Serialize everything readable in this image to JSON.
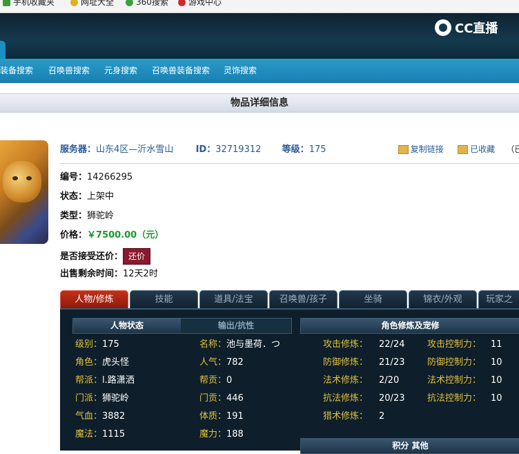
{
  "bookmarks": [
    {
      "label": "手机收藏夹",
      "color": "#3a9a3a"
    },
    {
      "label": "网址大全",
      "color": "#e0b020"
    },
    {
      "label": "360搜索",
      "color": "#3aa040"
    },
    {
      "label": "游戏中心",
      "color": "#d02a2a"
    }
  ],
  "header": {
    "logo": "CC直播"
  },
  "nav": [
    "装备搜索",
    "召唤兽搜索",
    "元身搜索",
    "召唤兽装备搜索",
    "灵饰搜索"
  ],
  "page_title": "物品详细信息",
  "info": {
    "server_label": "服务器：",
    "server_value": "山东4区—沂水雪山",
    "id_label": "ID：",
    "id_value": "32719312",
    "level_label": "等级：",
    "level_value": "175",
    "copy_link": "复制链接",
    "favorited": "已收藏",
    "trailing": "（已有"
  },
  "details": {
    "number_label": "编号：",
    "number_value": "14266295",
    "status_label": "状态：",
    "status_value": "上架中",
    "type_label": "类型：",
    "type_value": "狮驼岭",
    "price_label": "价格：",
    "price_value": "￥7500.00（元）",
    "haggle_label": "是否接受还价：",
    "haggle_button": "还价",
    "time_label": "出售剩余时间：",
    "time_value": "12天2时"
  },
  "tabs": [
    "人物/修炼",
    "技能",
    "道具/法宝",
    "召唤兽/孩子",
    "坐骑",
    "锦衣/外观",
    "玩家之"
  ],
  "subtabs": [
    "人物状态",
    "输出/抗性"
  ],
  "section_titles": {
    "cultivation": "角色修炼及宠修",
    "score": "积分 其他"
  },
  "stats_col1": [
    {
      "k": "级别：",
      "v": "175"
    },
    {
      "k": "角色：",
      "v": "虎头怪"
    },
    {
      "k": "帮派：",
      "v": "l.路潇洒"
    },
    {
      "k": "门派：",
      "v": "狮驼岭"
    },
    {
      "k": "气血：",
      "v": "3882"
    },
    {
      "k": "魔法：",
      "v": "1115"
    }
  ],
  "stats_col2": [
    {
      "k": "名称：",
      "v": "池与墨荷．つ"
    },
    {
      "k": "人气：",
      "v": "782"
    },
    {
      "k": "帮贡：",
      "v": "0"
    },
    {
      "k": "门贡：",
      "v": "446"
    },
    {
      "k": "体质：",
      "v": "191"
    },
    {
      "k": "魔力：",
      "v": "188"
    }
  ],
  "cultivation_col1": [
    {
      "k": "攻击修炼：",
      "v": "22/24"
    },
    {
      "k": "防御修炼：",
      "v": "21/23"
    },
    {
      "k": "法术修炼：",
      "v": "2/20"
    },
    {
      "k": "抗法修炼：",
      "v": "20/23"
    },
    {
      "k": "猎术修炼：",
      "v": "2"
    }
  ],
  "cultivation_col2": [
    {
      "k": "攻击控制力：",
      "v": "11"
    },
    {
      "k": "防御控制力：",
      "v": "10"
    },
    {
      "k": "法术控制力：",
      "v": "10"
    },
    {
      "k": "抗法控制力：",
      "v": "10"
    }
  ]
}
